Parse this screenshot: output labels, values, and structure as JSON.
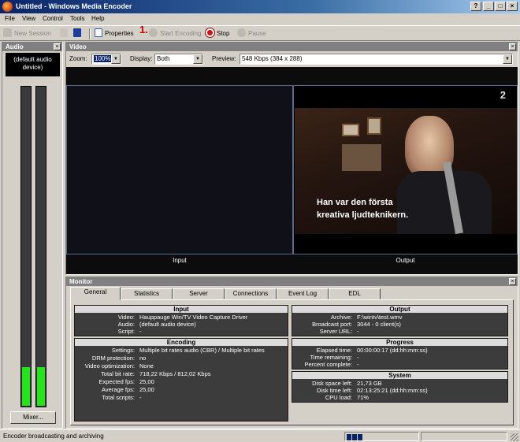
{
  "window": {
    "title": "Untitled - Windows Media Encoder"
  },
  "menu": [
    "File",
    "View",
    "Control",
    "Tools",
    "Help"
  ],
  "toolbar": {
    "new_session": "New Session",
    "properties": "Properties",
    "annotation": "1.",
    "start_encoding": "Start Encoding",
    "stop": "Stop",
    "pause": "Pause"
  },
  "audio": {
    "title": "Audio",
    "device": "(default audio device)",
    "left_level": 0.12,
    "right_level": 0.12,
    "mixer_label": "Mixer..."
  },
  "video": {
    "title": "Video",
    "zoom_label": "Zoom:",
    "zoom_value": "100%",
    "display_label": "Display:",
    "display_value": "Both",
    "preview_label": "Preview:",
    "preview_value": "548 Kbps (384 x 288)",
    "input_caption": "Input",
    "output_caption": "Output",
    "subtitle_line1": "Han var den första",
    "subtitle_line2": "kreativa ljudteknikern.",
    "channel_logo": "2"
  },
  "monitor": {
    "title": "Monitor",
    "tabs": [
      "General",
      "Statistics",
      "Server",
      "Connections",
      "Event Log",
      "EDL"
    ],
    "active_tab": "General",
    "input": {
      "title": "Input",
      "rows": [
        {
          "label": "Video:",
          "value": "Hauppauge Win/TV Video Capture Driver"
        },
        {
          "label": "Audio:",
          "value": "(default audio device)"
        },
        {
          "label": "Script:",
          "value": "-"
        }
      ]
    },
    "encoding": {
      "title": "Encoding",
      "rows": [
        {
          "label": "Settings:",
          "value": "Multiple bit rates audio (CBR) / Multiple bit rates"
        },
        {
          "label": "DRM protection:",
          "value": "no"
        },
        {
          "label": "Video optimization:",
          "value": "None"
        },
        {
          "label": "Total bit rate:",
          "value": "718,22 Kbps / 812,02 Kbps"
        },
        {
          "label": "Expected fps:",
          "value": "25,00"
        },
        {
          "label": "Average fps:",
          "value": "25,00"
        },
        {
          "label": "Total scripts:",
          "value": "-"
        }
      ]
    },
    "output": {
      "title": "Output",
      "rows": [
        {
          "label": "Archive:",
          "value": "F:\\wintv\\test.wmv"
        },
        {
          "label": "Broadcast port:",
          "value": "3044 - 0 client(s)"
        },
        {
          "label": "Server URL:",
          "value": "-"
        }
      ]
    },
    "progress": {
      "title": "Progress",
      "rows": [
        {
          "label": "Elapsed time:",
          "value": "00:00:00:17  (dd:hh:mm:ss)"
        },
        {
          "label": "Time remaining:",
          "value": "-"
        },
        {
          "label": "Percent complete:",
          "value": "-"
        }
      ]
    },
    "system": {
      "title": "System",
      "rows": [
        {
          "label": "Disk space left:",
          "value": "21,73 GB"
        },
        {
          "label": "Disk time left:",
          "value": "02:13:25:21  (dd:hh:mm:ss)"
        },
        {
          "label": "CPU load:",
          "value": "71%"
        }
      ]
    }
  },
  "status": {
    "text": "Encoder broadcasting and archiving"
  }
}
